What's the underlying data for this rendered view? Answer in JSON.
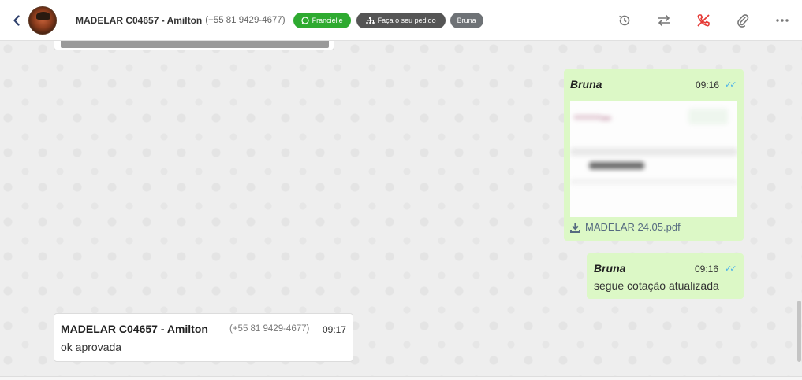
{
  "header": {
    "contact_name": "MADELAR C04657 - Amilton",
    "contact_phone": "(+55 81 9429-4677)",
    "tags": {
      "whatsapp_agent": "Francielle",
      "sector": "Faça o seu pedido",
      "assignee": "Bruna"
    },
    "icons": [
      "back-icon",
      "whatsapp-icon",
      "sitemap-icon",
      "history-icon",
      "transfer-icon",
      "end-call-icon",
      "paperclip-icon",
      "more-icon"
    ],
    "end_call_color": "#e53935"
  },
  "messages": [
    {
      "direction": "out",
      "sender": "Bruna",
      "time": "09:16",
      "attachment_name": "MADELAR 24.05.pdf"
    },
    {
      "direction": "out",
      "sender": "Bruna",
      "time": "09:16",
      "text": "segue cotação atualizada"
    },
    {
      "direction": "in",
      "sender": "MADELAR C04657 - Amilton",
      "phone": "(+55 81 9429-4677)",
      "time": "09:17",
      "text": "ok aprovada"
    }
  ],
  "colors": {
    "outgoing_bubble": "#dcf8c6",
    "incoming_bubble": "#ffffff",
    "read_ticks": "#4fb3e8",
    "tag_green": "#2eaa30"
  }
}
